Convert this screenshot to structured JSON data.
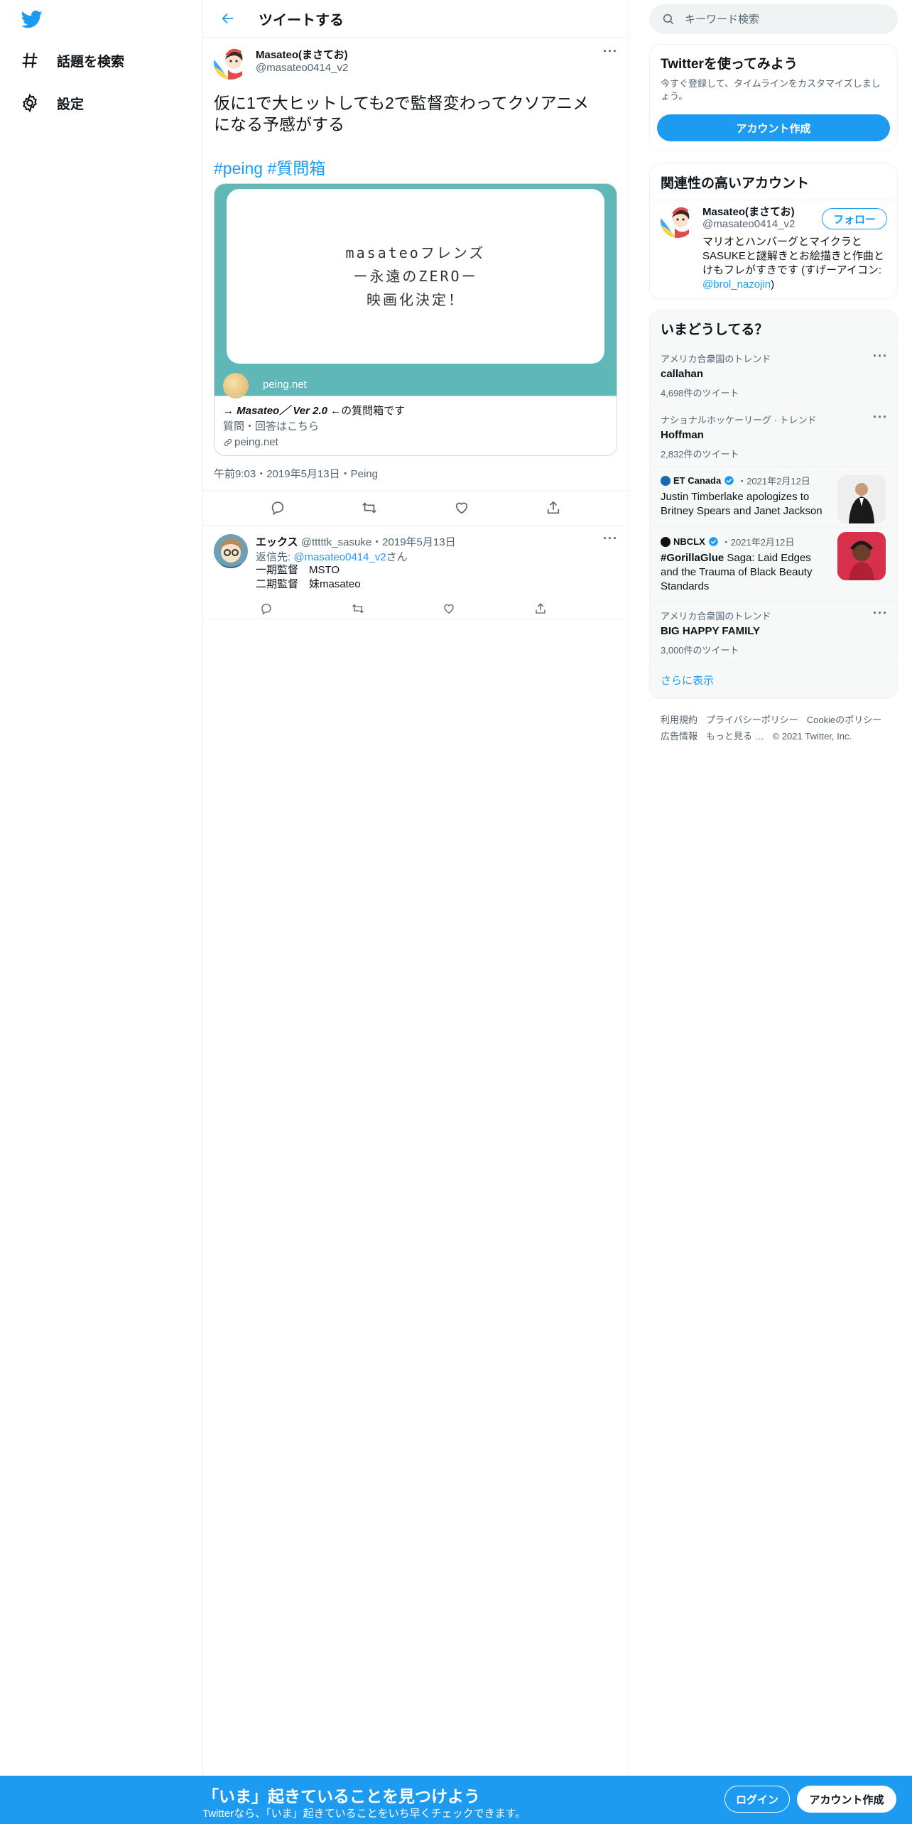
{
  "nav": {
    "items": [
      {
        "label": "話題を検索",
        "icon": "hashtag-icon"
      },
      {
        "label": "設定",
        "icon": "gear-icon"
      }
    ]
  },
  "header": {
    "title": "ツイートする"
  },
  "tweet": {
    "author_name": "Masateo(まさてお)",
    "author_handle": "@masateo0414_v2",
    "text_line1": "仮に1で大ヒットしても2で監督変わってクソアニメ",
    "text_line2": "になる予感がする",
    "hashtags": "#peing #質問箱",
    "card": {
      "image_line1": "masateoフレンズ",
      "image_line2": "ー永遠のZEROー",
      "image_line3": "映画化決定！",
      "image_site": "peing.net",
      "title_prefix": "→ ",
      "title_bold": "Masateo／ Ver 2.0",
      "title_suffix": " ←の質問箱です",
      "description": "質問・回答はこちら",
      "domain": "peing.net"
    },
    "timestamp": "午前9:03・2019年5月13日・Peing"
  },
  "reply": {
    "author_name": "エックス",
    "author_handle": "@tttttk_sasuke",
    "date": "・2019年5月13日",
    "replying_prefix": "返信先: ",
    "replying_to": "@masateo0414_v2",
    "replying_suffix": "さん",
    "line1": "一期監督　MSTO",
    "line2": "二期監督　妹masateo"
  },
  "search": {
    "placeholder": "キーワード検索"
  },
  "signup_panel": {
    "title": "Twitterを使ってみよう",
    "desc": "今すぐ登録して、タイムラインをカスタマイズしましょう。",
    "button": "アカウント作成"
  },
  "related": {
    "title": "関連性の高いアカウント",
    "name": "Masateo(まさてお)",
    "handle": "@masateo0414_v2",
    "follow": "フォロー",
    "bio": "マリオとハンバーグとマイクラとSASUKEと謎解きとお絵描きと作曲とけもフレがすきです (すげーアイコン: ",
    "bio_link": "@brol_nazojin",
    "bio_end": ")"
  },
  "trends": {
    "title": "いまどうしてる？",
    "items": [
      {
        "context": "アメリカ合衆国のトレンド",
        "title": "callahan",
        "count": "4,698件のツイート"
      },
      {
        "context": "ナショナルホッケーリーグ · トレンド",
        "title": "Hoffman",
        "count": "2,832件のツイート"
      },
      {
        "source": "ET Canada",
        "date": "・2021年2月12日",
        "text": "Justin Timberlake apologizes to Britney Spears and Janet Jackson"
      },
      {
        "source": "NBCLX",
        "date": "・2021年2月12日",
        "text_bold": "#GorillaGlue",
        "text": " Saga: Laid Edges and the Trauma of Black Beauty Standards"
      },
      {
        "context": "アメリカ合衆国のトレンド",
        "title": "BIG HAPPY FAMILY",
        "count": "3,000件のツイート"
      }
    ],
    "more": "さらに表示"
  },
  "footer": {
    "links": [
      "利用規約",
      "プライバシーポリシー",
      "Cookieのポリシー",
      "広告情報",
      "もっと見る …",
      "© 2021 Twitter, Inc."
    ]
  },
  "bottombar": {
    "title": "「いま」起きていることを見つけよう",
    "subtitle": "Twitterなら、「いま」起きていることをいち早くチェックできます。",
    "login": "ログイン",
    "signup": "アカウント作成"
  },
  "colors": {
    "accent": "#1d9bf0",
    "text": "#0f1419",
    "muted": "#536471",
    "card_bg": "#5fb8b7"
  }
}
